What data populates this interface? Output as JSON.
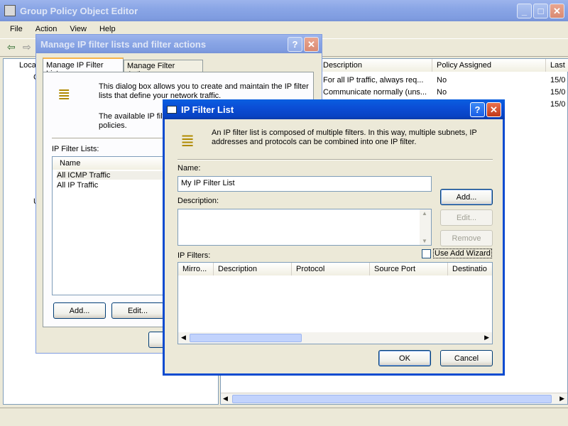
{
  "main_window": {
    "title": "Group Policy Object Editor",
    "menu": [
      "File",
      "Action",
      "View",
      "Help"
    ],
    "tree": {
      "root_label": "Loca",
      "items_visible": [
        "C",
        "U"
      ]
    },
    "list_columns": [
      "Description",
      "Policy Assigned",
      "Last"
    ],
    "list_rows": [
      {
        "description": "For all IP traffic, always req...",
        "policy": "No",
        "last": "15/0"
      },
      {
        "description": "Communicate normally (uns...",
        "policy": "No",
        "last": "15/0"
      },
      {
        "description": "",
        "policy": "",
        "last": "15/0"
      }
    ]
  },
  "manage_dialog": {
    "title": "Manage IP filter lists and filter actions",
    "tabs": [
      "Manage IP Filter Lists",
      "Manage Filter Actions"
    ],
    "intro_text": "This dialog box allows you to create and maintain the IP filter lists that define your network traffic.",
    "intro_text2": "The available IP filt... policies.",
    "intro_text2_a": "The available IP filt",
    "intro_text2_b": "policies.",
    "lists_label": "IP Filter Lists:",
    "column_name": "Name",
    "rows": [
      "All ICMP Traffic",
      "All IP Traffic"
    ],
    "add_label": "Add...",
    "edit_label": "Edit..."
  },
  "filter_dialog": {
    "title": "IP Filter List",
    "intro_text": "An IP filter list is composed of multiple filters. In this way, multiple subnets, IP addresses and protocols can be combined into one IP filter.",
    "name_label": "Name:",
    "name_value": "My IP Filter List",
    "description_label": "Description:",
    "description_value": "",
    "add_label": "Add...",
    "edit_label": "Edit...",
    "remove_label": "Remove",
    "filters_label": "IP Filters:",
    "use_wizard_label": "Use Add Wizard",
    "use_wizard_checked": false,
    "columns": [
      "Mirro...",
      "Description",
      "Protocol",
      "Source Port",
      "Destinatio"
    ],
    "ok_label": "OK",
    "cancel_label": "Cancel"
  }
}
